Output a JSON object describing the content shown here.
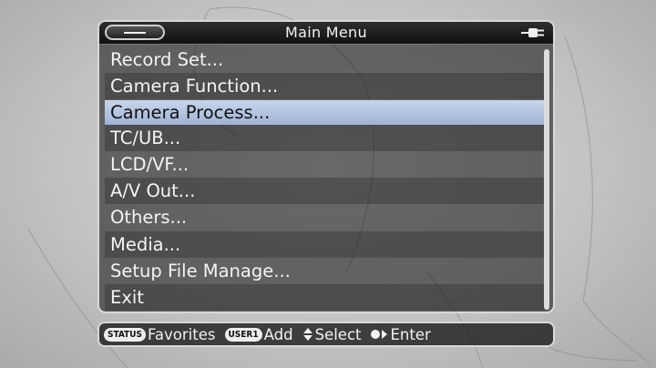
{
  "window": {
    "title": "Main Menu",
    "back_icon": "minus-icon",
    "power_icon": "power-plug-icon"
  },
  "menu": {
    "items": [
      {
        "label": "Record Set...",
        "selected": false
      },
      {
        "label": "Camera Function...",
        "selected": false
      },
      {
        "label": "Camera Process...",
        "selected": true
      },
      {
        "label": "TC/UB...",
        "selected": false
      },
      {
        "label": "LCD/VF...",
        "selected": false
      },
      {
        "label": "A/V Out...",
        "selected": false
      },
      {
        "label": "Others...",
        "selected": false
      },
      {
        "label": "Media...",
        "selected": false
      },
      {
        "label": "Setup File Manage...",
        "selected": false
      },
      {
        "label": "Exit",
        "selected": false
      }
    ]
  },
  "footer": {
    "status_key": "STATUS",
    "favorites": "Favorites",
    "user1_key": "USER1",
    "add": "Add",
    "select": "Select",
    "enter": "Enter"
  },
  "colors": {
    "selection": "#b4c6e4",
    "panel": "#1a1a1a",
    "text": "#f4f4f4"
  }
}
